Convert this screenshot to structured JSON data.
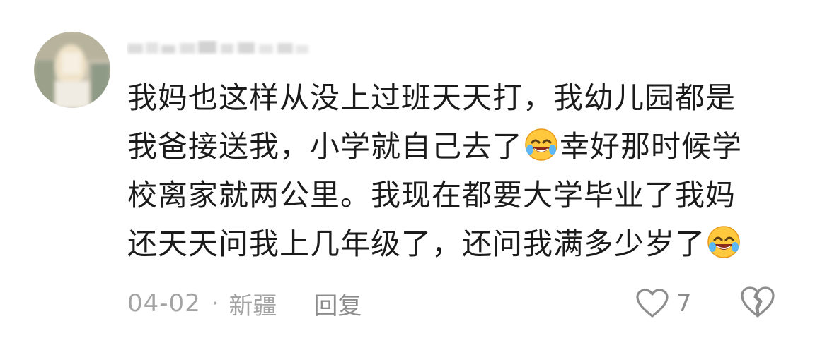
{
  "comment": {
    "avatar_icon": "blurred-avatar",
    "username_icon": "blurred-username",
    "lines": [
      [
        "我妈也这样从没上过班天天打，我幼儿园都是"
      ],
      [
        "我爸接送我，小学就自己去了",
        "幸好那时候学"
      ],
      [
        "校离家就两公里。我现在都要大学毕业了我妈"
      ],
      [
        "还天天问我上几年级了，还问我满多少岁了"
      ]
    ],
    "emoji": "rolling-on-floor-laughing"
  },
  "meta": {
    "date": "04-02",
    "separator": "·",
    "location": "新疆",
    "reply_label": "回复"
  },
  "actions": {
    "like_icon": "heart-outline-icon",
    "like_count": "7",
    "dislike_icon": "broken-heart-icon"
  },
  "colors": {
    "text": "#1b1b1b",
    "meta_text": "#a4a4a4",
    "icon": "#8d8d8d"
  }
}
